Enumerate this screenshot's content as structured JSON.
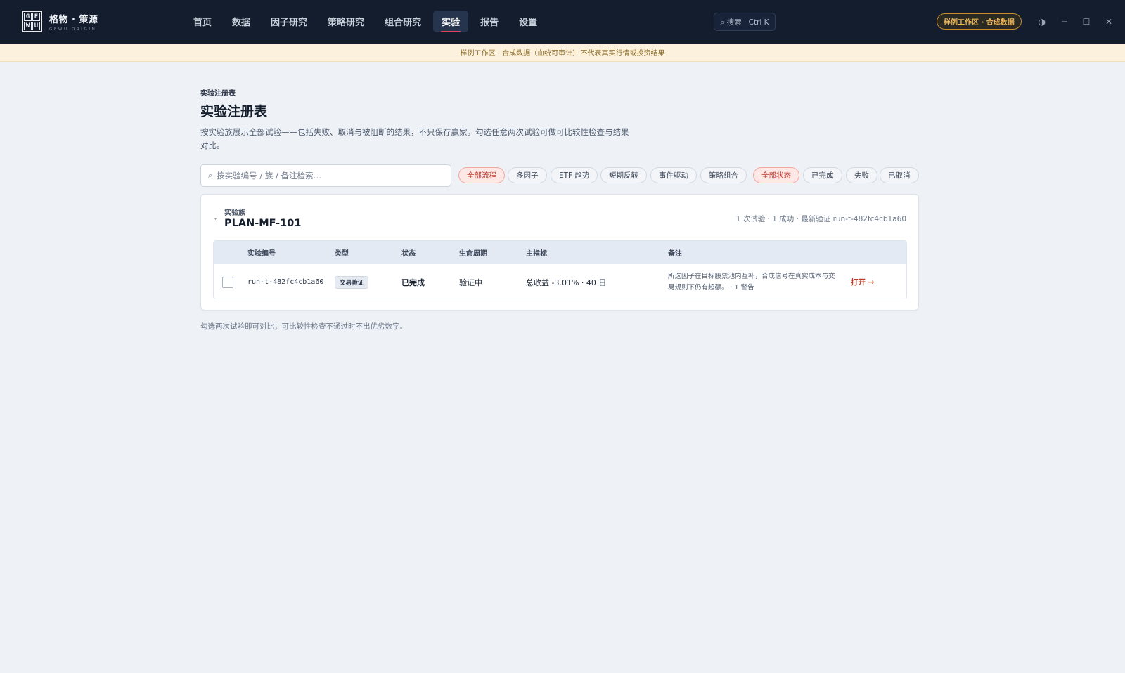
{
  "app": {
    "logo_letters": [
      "G",
      "E",
      "W",
      "U"
    ],
    "title": "格物 · 策源",
    "subtitle": "GEWU ORIGIN"
  },
  "nav": {
    "items": [
      {
        "label": "首页"
      },
      {
        "label": "数据"
      },
      {
        "label": "因子研究"
      },
      {
        "label": "策略研究"
      },
      {
        "label": "组合研究"
      },
      {
        "label": "实验",
        "active": true
      },
      {
        "label": "报告"
      },
      {
        "label": "设置"
      }
    ]
  },
  "topbar": {
    "search_label": "⌕ 搜索 · Ctrl K",
    "workspace_badge": "样例工作区 · 合成数据",
    "window_buttons": {
      "theme_icon": "◑",
      "minimize_icon": "─",
      "maximize_icon": "☐",
      "close_icon": "✕"
    }
  },
  "banner": {
    "text": "样例工作区 · 合成数据（血统可审计）· 不代表真实行情或投资结果"
  },
  "page": {
    "eyebrow": "实验注册表",
    "title": "实验注册表",
    "description": "按实验族展示全部试验——包括失败、取消与被阻断的结果，不只保存赢家。勾选任意两次试验可做可比较性检查与结果对比。"
  },
  "filters": {
    "search_placeholder": "按实验编号 / 族 / 备注检索…",
    "search_icon": "⌕",
    "flow_chips": [
      {
        "label": "全部流程",
        "active": true
      },
      {
        "label": "多因子"
      },
      {
        "label": "ETF 趋势"
      },
      {
        "label": "短期反转"
      },
      {
        "label": "事件驱动"
      },
      {
        "label": "策略组合"
      }
    ],
    "status_chips": [
      {
        "label": "全部状态",
        "active": true
      },
      {
        "label": "已完成"
      },
      {
        "label": "失败"
      },
      {
        "label": "已取消"
      }
    ]
  },
  "family": {
    "chevron": "˅",
    "eyebrow": "实验族",
    "title": "PLAN-MF-101",
    "meta": "1 次试验 · 1 成功 · 最新验证 run-t-482fc4cb1a60",
    "columns": [
      "实验编号",
      "类型",
      "状态",
      "生命周期",
      "主指标",
      "备注"
    ],
    "rows": [
      {
        "run_id": "run-t-482fc4cb1a60",
        "type": "交易验证",
        "status": "已完成",
        "lifecycle": "验证中",
        "metric": "总收益 -3.01% · 40 日",
        "note": "所选因子在目标股票池内互补，合成信号在真实成本与交易规则下仍有超额。 · 1 警告",
        "action": "打开 →"
      }
    ]
  },
  "footer": {
    "note": "勾选两次试验即可对比；可比较性检查不通过时不出优劣数字。"
  },
  "colors": {
    "topbar": "#131d2e",
    "accent": "#e0435b",
    "badge": "#f0b85a",
    "chip_active": "#c0392b",
    "background": "#eef1f6"
  }
}
